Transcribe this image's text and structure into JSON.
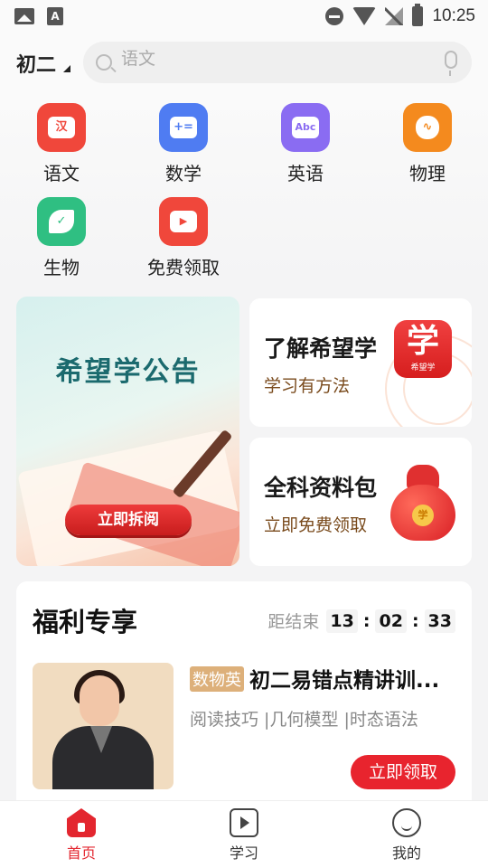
{
  "status_bar": {
    "time": "10:25",
    "notif_a": "A"
  },
  "header": {
    "grade": "初二",
    "search_placeholder": "语文"
  },
  "subjects": [
    {
      "label": "语文",
      "icon": "han-character-icon",
      "glyph": "汉",
      "color": "#f0473b"
    },
    {
      "label": "数学",
      "icon": "calculator-icon",
      "glyph": "+=",
      "color": "#4f7cf2"
    },
    {
      "label": "英语",
      "icon": "abc-icon",
      "glyph": "Abc",
      "color": "#8a6cf2"
    },
    {
      "label": "物理",
      "icon": "bulb-icon",
      "glyph": "∿",
      "color": "#f48a1e"
    },
    {
      "label": "生物",
      "icon": "leaf-icon",
      "glyph": "✓",
      "color": "#2fbf82"
    },
    {
      "label": "免费领取",
      "icon": "play-folder-icon",
      "glyph": "▶",
      "color": "#f0473b"
    }
  ],
  "announcement": {
    "title": "希望学公告",
    "button": "立即拆阅"
  },
  "about_card": {
    "title": "了解希望学",
    "subtitle": "学习有方法",
    "logo_big": "学",
    "logo_small": "希望学"
  },
  "materials_card": {
    "title": "全科资料包",
    "subtitle": "立即免费领取",
    "coin": "学"
  },
  "welfare": {
    "title": "福利专享",
    "countdown_label": "距结束",
    "hours": "13",
    "minutes": "02",
    "seconds": "33",
    "course": {
      "tag": "数物英",
      "name": "初二易错点精讲训...",
      "desc": "阅读技巧 |几何模型 |时态语法",
      "button": "立即领取"
    }
  },
  "nav": [
    {
      "label": "首页",
      "icon": "home-icon",
      "active": true
    },
    {
      "label": "学习",
      "icon": "play-square-icon",
      "active": false
    },
    {
      "label": "我的",
      "icon": "smiley-icon",
      "active": false
    }
  ],
  "colors": {
    "accent": "#e3262f",
    "brown_text": "#7a4b1d"
  }
}
